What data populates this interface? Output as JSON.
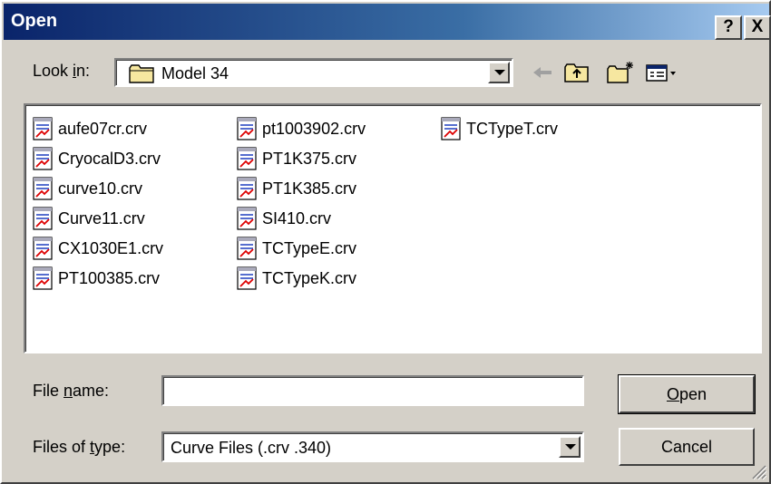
{
  "window": {
    "title": "Open",
    "help_label": "?",
    "close_label": "X"
  },
  "lookin": {
    "label_before": "Look ",
    "label_accel": "i",
    "label_after": "n:",
    "value": "Model 34",
    "folder_icon": "folder-icon"
  },
  "toolbar": {
    "icons": [
      "back-arrow-icon",
      "up-folder-icon",
      "new-folder-icon",
      "view-menu-icon"
    ]
  },
  "files": [
    "aufe07cr.crv",
    "CryocalD3.crv",
    "curve10.crv",
    "Curve11.crv",
    "CX1030E1.crv",
    "PT100385.crv",
    "pt1003902.crv",
    "PT1K375.crv",
    "PT1K385.crv",
    "SI410.crv",
    "TCTypeE.crv",
    "TCTypeK.crv",
    "TCTypeT.crv"
  ],
  "filename": {
    "label_before": "File ",
    "label_accel": "n",
    "label_after": "ame:",
    "value": ""
  },
  "filetype": {
    "label_before": "Files of ",
    "label_accel": "t",
    "label_after": "ype:",
    "value": "Curve Files (.crv .340)"
  },
  "buttons": {
    "open_accel": "O",
    "open_rest": "pen",
    "cancel": "Cancel"
  }
}
